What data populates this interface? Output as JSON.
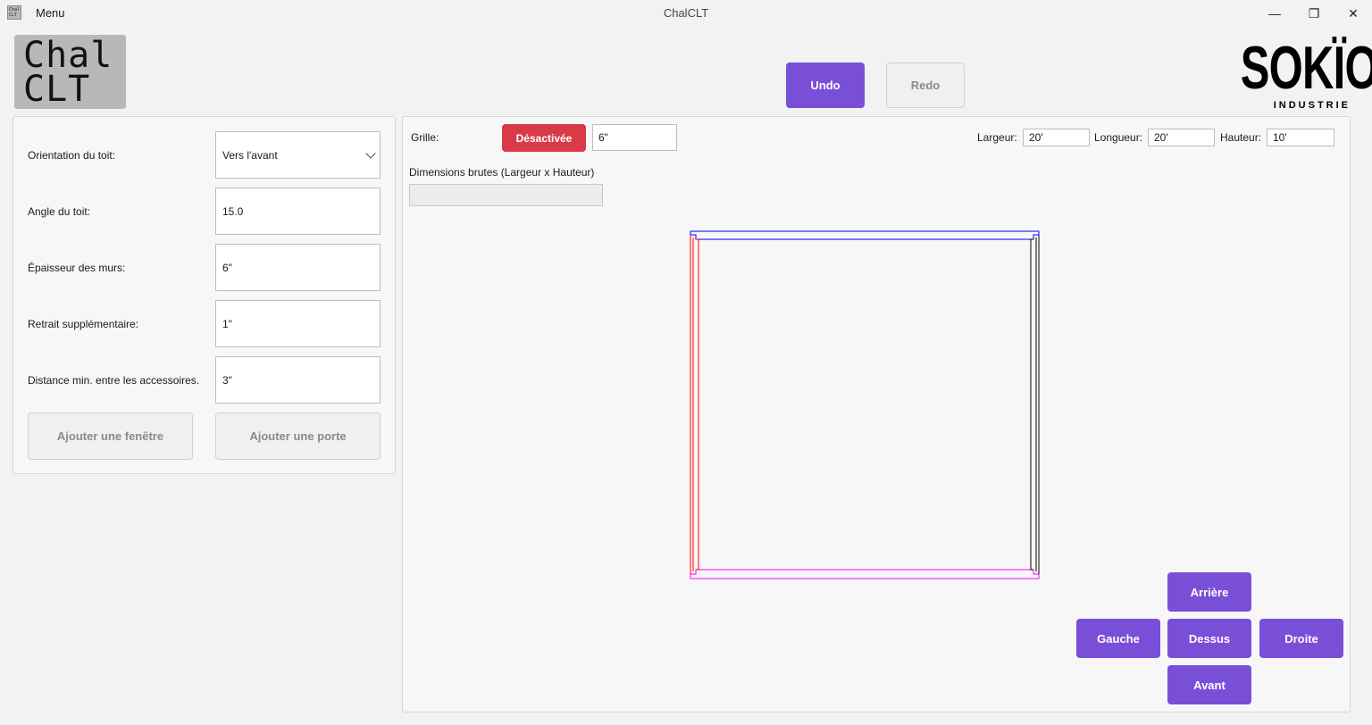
{
  "titlebar": {
    "app_icon_text": "Chal CLT",
    "menu_label": "Menu",
    "title": "ChalCLT",
    "minimize_glyph": "—",
    "maximize_glyph": "❐",
    "close_glyph": "✕"
  },
  "logos": {
    "chal_line1": "Chal",
    "chal_line2": "CLT",
    "sokio_main": "SOKÏO",
    "sokio_sub": "INDUSTRIE"
  },
  "history": {
    "undo_label": "Undo",
    "redo_label": "Redo"
  },
  "settings": {
    "fields": [
      {
        "label": "Orientation du toit:",
        "value": "Vers l'avant",
        "type": "select"
      },
      {
        "label": "Angle du toit:",
        "value": "15.0",
        "type": "input"
      },
      {
        "label": "Épaisseur des murs:",
        "value": "6\"",
        "type": "input"
      },
      {
        "label": "Retrait supplémentaire:",
        "value": "1\"",
        "type": "input"
      },
      {
        "label": "Distance min. entre les accessoires.",
        "value": "3\"",
        "type": "input"
      }
    ],
    "add_window_label": "Ajouter une fenêtre",
    "add_door_label": "Ajouter une porte"
  },
  "toolbar": {
    "grid_label": "Grille:",
    "grid_toggle_label": "Désactivée",
    "grid_size_value": "6\"",
    "width_label": "Largeur:",
    "width_value": "20'",
    "length_label": "Longueur:",
    "length_value": "20'",
    "height_label": "Hauteur:",
    "height_value": "10'",
    "raw_dims_label": "Dimensions brutes (Largeur x Hauteur)",
    "raw_dims_value": ""
  },
  "plan_colors": {
    "front_wall": "#ff00ff",
    "back_wall": "#0000ff",
    "left_wall": "#ff0000",
    "right_wall": "#000000"
  },
  "view_buttons": {
    "back": "Arrière",
    "left": "Gauche",
    "top": "Dessus",
    "right": "Droite",
    "front": "Avant"
  }
}
